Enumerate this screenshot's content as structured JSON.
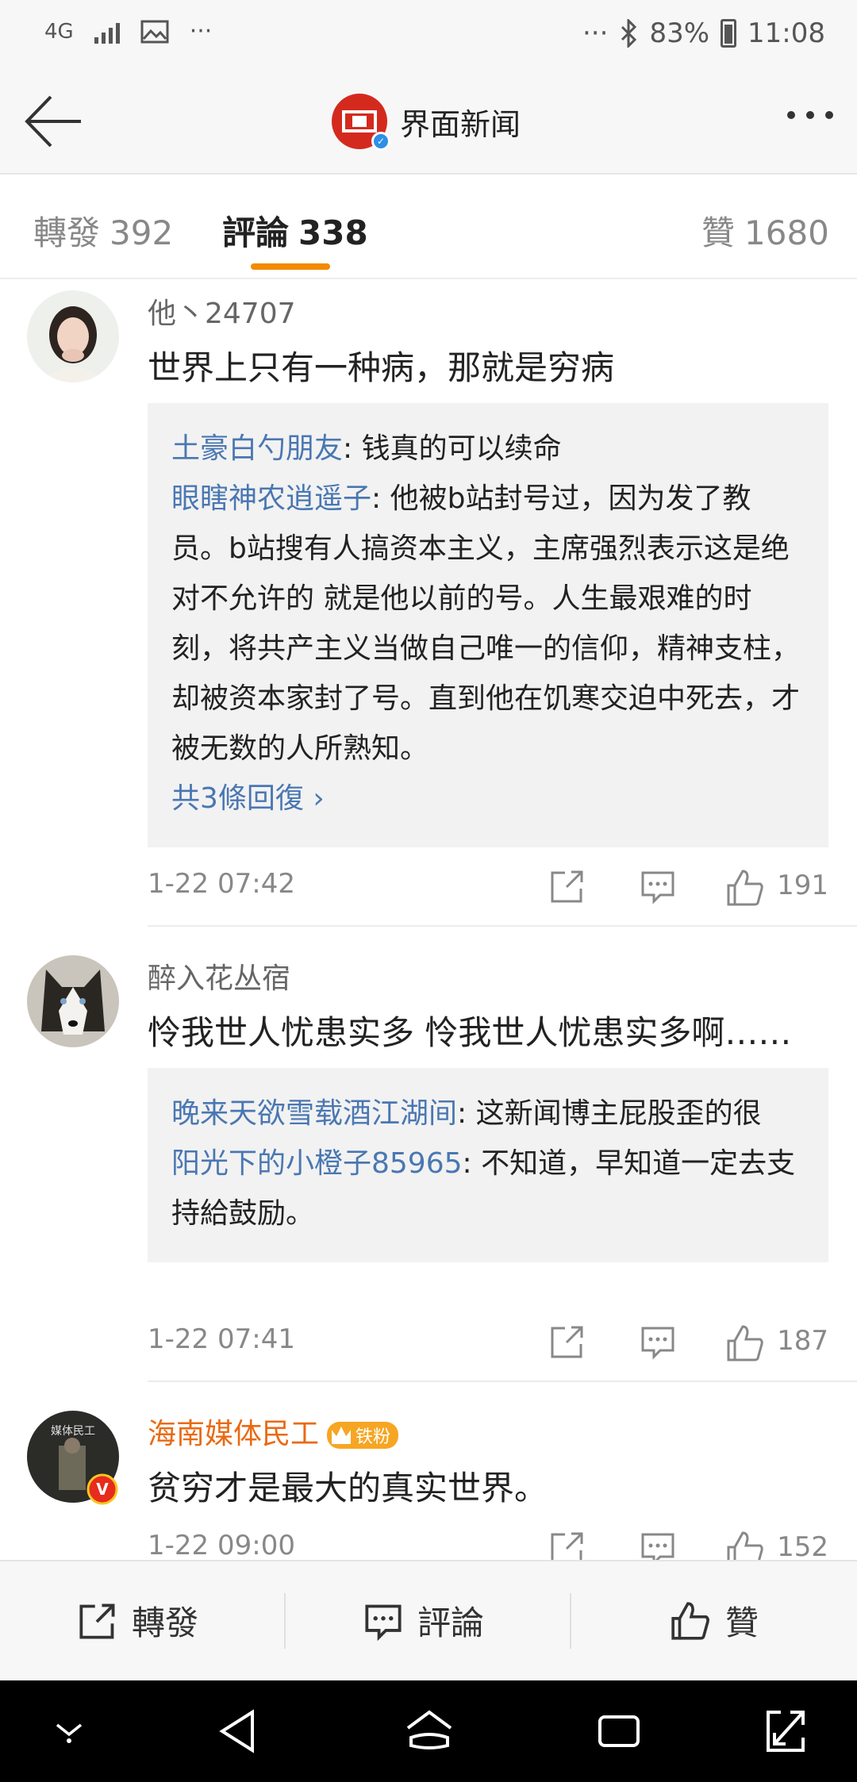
{
  "status_bar": {
    "network": "4G",
    "overflow_left": "···",
    "overflow_right": "···",
    "battery": "83%",
    "time": "11:08"
  },
  "header": {
    "title": "界面新闻",
    "icons": [
      "back-arrow-icon",
      "news-logo-icon",
      "verified-badge-icon",
      "more-dots-icon"
    ]
  },
  "tabs": [
    {
      "label": "轉發",
      "count": "392"
    },
    {
      "label": "評論",
      "count": "338"
    },
    {
      "label": "贊",
      "count": "1680"
    }
  ],
  "colors": {
    "accent": "#f38a00",
    "link": "#4a77b2",
    "brand_red": "#d42a1e",
    "fan_badge": "#f6a623",
    "username_highlight": "#e96a13"
  },
  "comments": [
    {
      "username": "他丶24707",
      "text": "世界上只有一种病，那就是穷病",
      "replies": [
        {
          "name": "土豪白勺朋友",
          "text": ": 钱真的可以续命"
        },
        {
          "name": "眼瞎神农逍遥子",
          "text": ": 他被b站封号过，因为发了教员。b站搜有人搞资本主义，主席强烈表示这是绝对不允许的 就是他以前的号。人生最艰难的时刻，将共产主义当做自己唯一的信仰，精神支柱，却被资本家封了号。直到他在饥寒交迫中死去，才被无数的人所熟知。"
        }
      ],
      "more_replies": "共3條回復 ›",
      "time": "1-22 07:42",
      "likes": "191"
    },
    {
      "username": "醉入花丛宿",
      "text": "怜我世人忧患实多 怜我世人忧患实多啊……",
      "replies": [
        {
          "name": "晚来天欲雪载酒江湖间",
          "text": ": 这新闻博主屁股歪的很"
        },
        {
          "name": "阳光下的小橙子85965",
          "text": ": 不知道，早知道一定去支持給鼓励。"
        }
      ],
      "time": "1-22 07:41",
      "likes": "187"
    },
    {
      "username": "海南媒体民工",
      "badge": "铁粉",
      "avatar_text": "媒体民工",
      "text": "贫穷才是最大的真实世界。",
      "time": "1-22 09:00",
      "likes": "152"
    }
  ],
  "bottom_bar": {
    "repost": "轉發",
    "comment": "評論",
    "like": "贊"
  }
}
